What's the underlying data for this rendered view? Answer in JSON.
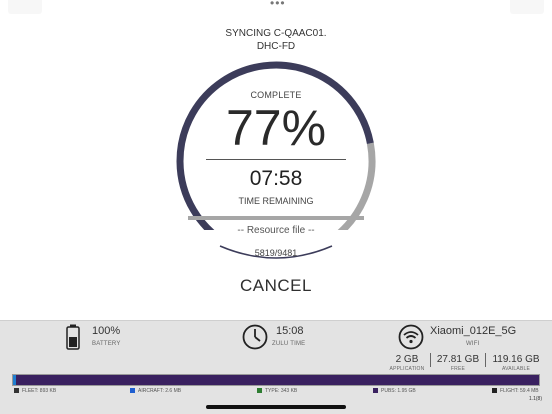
{
  "header": {
    "more_glyph": "•••"
  },
  "sync": {
    "title_line1": "SYNCING C-QAAC01.",
    "title_line2": "DHC-FD",
    "complete_label": "COMPLETE",
    "percent_text": "77%",
    "progress": 0.77,
    "time_remaining": "07:58",
    "time_label": "TIME REMAINING",
    "resource_label": "-- Resource file --",
    "counter": "5819/9481",
    "cancel_label": "CANCEL"
  },
  "status": {
    "battery": {
      "value": "100%",
      "label": "BATTERY",
      "icon": "battery-icon"
    },
    "zulu": {
      "value": "15:08",
      "label": "ZULU TIME",
      "icon": "clock-icon"
    },
    "wifi": {
      "value": "Xiaomi_012E_5G",
      "label": "WIFI",
      "icon": "wifi-icon"
    }
  },
  "storage": {
    "application": {
      "value": "2 GB",
      "label": "APPLICATION"
    },
    "free": {
      "value": "27.81 GB",
      "label": "FREE"
    },
    "available": {
      "value": "119.16 GB",
      "label": "AVAILABLE"
    },
    "legend": [
      {
        "label": "FLEET: 893 KB",
        "color": "#333333"
      },
      {
        "label": "AIRCRAFT: 2.6 MB",
        "color": "#1f5fd0"
      },
      {
        "label": "TYPE: 343 KB",
        "color": "#2e7d32"
      },
      {
        "label": "PUBS: 1.95 GB",
        "color": "#3a2160"
      },
      {
        "label": "FLIGHT: 59.4 MB",
        "color": "#222222"
      }
    ],
    "version": "1.1(8)"
  },
  "colors": {
    "ring_dark": "#3c3c5a",
    "ring_light": "#a6a6a6",
    "panel": "#e3e3e3",
    "bar": "#3a2160"
  }
}
